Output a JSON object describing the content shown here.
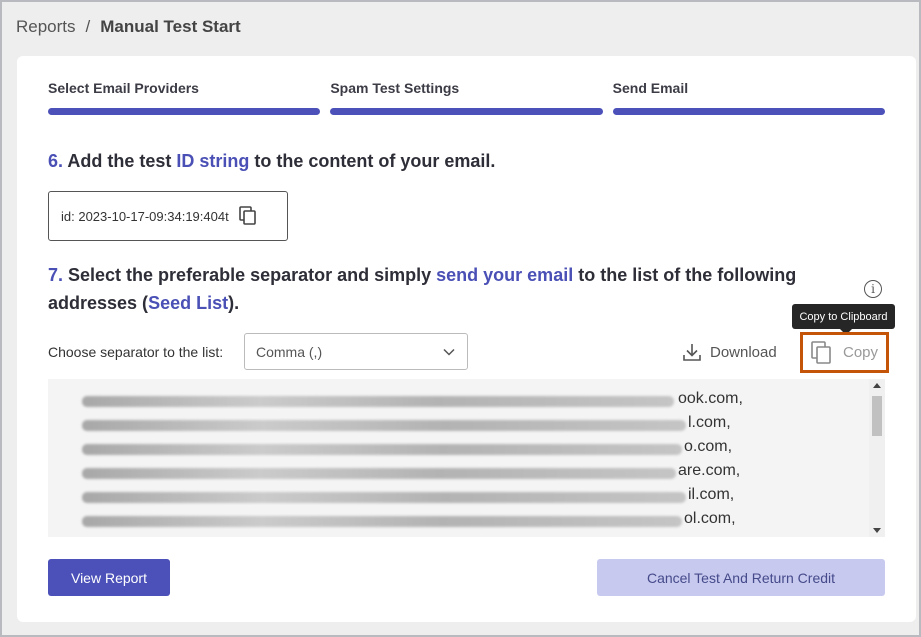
{
  "breadcrumb": {
    "parent": "Reports",
    "separator": "/",
    "current": "Manual Test Start"
  },
  "steps": [
    {
      "label": "Select Email Providers"
    },
    {
      "label": "Spam Test Settings"
    },
    {
      "label": "Send Email"
    }
  ],
  "instruction6": {
    "num": "6.",
    "pre": " Add the test ",
    "highlight": "ID string",
    "post": " to the content of your email."
  },
  "test_id": "id: 2023-10-17-09:34:19:404t",
  "instruction7": {
    "num": "7.",
    "pre": " Select the preferable separator and simply ",
    "highlight1": "send your email",
    "mid": " to the list of the following addresses (",
    "highlight2": "Seed List",
    "post": ")."
  },
  "info_icon": "i",
  "tooltip": "Copy to Clipboard",
  "separator": {
    "label": "Choose separator to the list:",
    "selected": "Comma (,)"
  },
  "download_label": "Download",
  "copy_label": "Copy",
  "seed_list": [
    "ook.com,",
    "l.com,",
    "o.com,",
    "are.com,",
    "il.com,",
    "ol.com,"
  ],
  "buttons": {
    "view_report": "View Report",
    "cancel": "Cancel Test And Return Credit"
  },
  "colors": {
    "accent": "#4b51b8",
    "highlight_border": "#c45508"
  }
}
